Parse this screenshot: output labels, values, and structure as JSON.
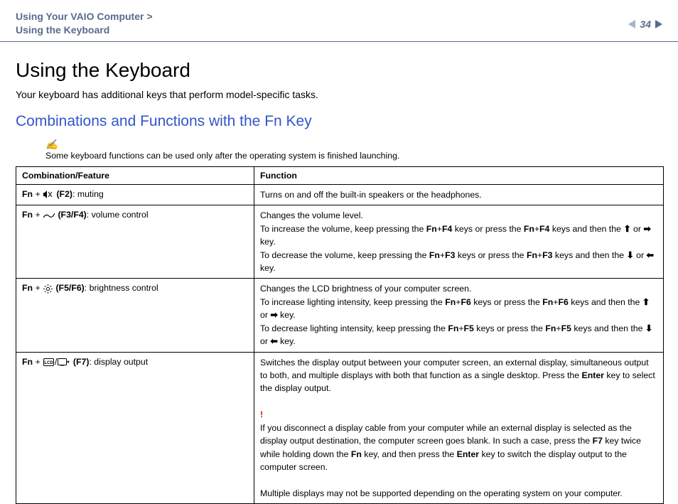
{
  "header": {
    "breadcrumb_line1": "Using Your VAIO Computer >",
    "breadcrumb_line2": "Using the Keyboard",
    "page_number": "34"
  },
  "main": {
    "h1": "Using the Keyboard",
    "intro": "Your keyboard has additional keys that perform model-specific tasks.",
    "h2": "Combinations and Functions with the Fn Key",
    "note_icon": "✍",
    "note_text": "Some keyboard functions can be used only after the operating system is finished launching."
  },
  "table": {
    "header_col1": "Combination/Feature",
    "header_col2": "Function",
    "rows": [
      {
        "fn": "Fn",
        "plus": " + ",
        "key": " (F2)",
        "label": ": muting",
        "func_plain": "Turns on and off the built-in speakers or the headphones."
      },
      {
        "fn": "Fn",
        "plus": " + ",
        "key": " (F3/F4)",
        "label": ": volume control",
        "f_line1": "Changes the volume level.",
        "f_inc_a": "To increase the volume, keep pressing the ",
        "f_inc_b": " keys or press the ",
        "f_inc_c": " keys and then the ",
        "f_key_inc": "Fn",
        "f_key_inc2": "F4",
        "f_dec_a": "To decrease the volume, keep pressing the ",
        "f_key_dec": "Fn",
        "f_key_dec2": "F3",
        "plus_sym": "+",
        "or": " or ",
        "keytail": " key."
      },
      {
        "fn": "Fn",
        "plus": " + ",
        "key": " (F5/F6)",
        "label": ": brightness control",
        "f_line1": "Changes the LCD brightness of your computer screen.",
        "f_inc_a": "To increase lighting intensity, keep pressing the ",
        "f_inc_b": " keys or press the ",
        "f_inc_c": " keys and then the ",
        "f_key_inc": "Fn",
        "f_key_inc2": "F6",
        "f_dec_a": "To decrease lighting intensity, keep pressing the ",
        "f_key_dec": "Fn",
        "f_key_dec2": "F5",
        "plus_sym": "+",
        "or": " or ",
        "keytail": " key."
      },
      {
        "fn": "Fn",
        "plus": " + ",
        "slash": "/",
        "key": " (F7)",
        "label": ": display output",
        "f_p1a": "Switches the display output between your computer screen, an external display, simultaneous output to both, and multiple displays with both that function as a single desktop. Press the ",
        "f_enter": "Enter",
        "f_p1b": " key to select the display output.",
        "warn": "!",
        "f_p2a": "If you disconnect a display cable from your computer while an external display is selected as the display output destination, the computer screen goes blank. In such a case, press the ",
        "f_f7": "F7",
        "f_p2b": " key twice while holding down the ",
        "f_fn": "Fn",
        "f_p2c": " key, and then press the ",
        "f_p2d": " key to switch the display output to the computer screen.",
        "f_p3": "Multiple displays may not be supported depending on the operating system on your computer."
      }
    ]
  }
}
